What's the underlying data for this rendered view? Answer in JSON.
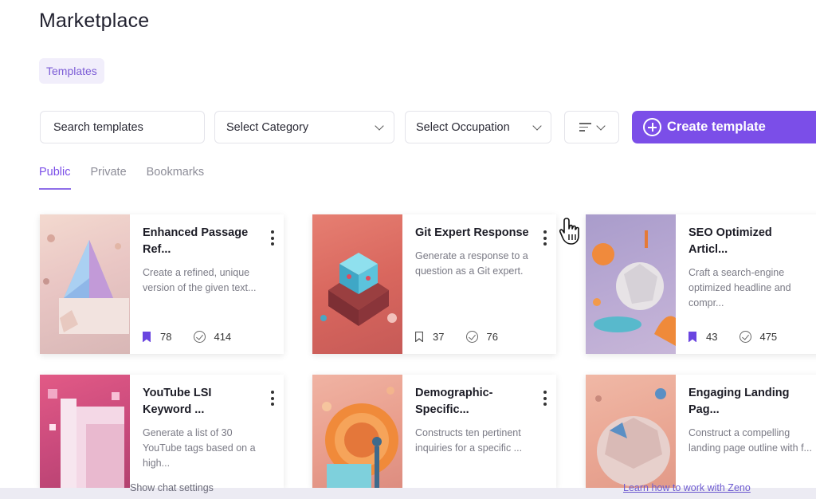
{
  "header": {
    "title": "Marketplace"
  },
  "chip": {
    "label": "Templates"
  },
  "toolbar": {
    "search_placeholder": "Search templates",
    "category_label": "Select Category",
    "occupation_label": "Select Occupation",
    "sort_icon": "sort-icon",
    "create_label": "Create template"
  },
  "tabs": [
    {
      "label": "Public",
      "active": true
    },
    {
      "label": "Private",
      "active": false
    },
    {
      "label": "Bookmarks",
      "active": false
    }
  ],
  "cards": [
    {
      "title": "Enhanced Passage Ref...",
      "description": "Create a refined, unique version of the given text...",
      "bookmarks": "78",
      "uses": "414",
      "bookmarked": true
    },
    {
      "title": "Git Expert Response",
      "description": "Generate a response to a question as a Git expert.",
      "bookmarks": "37",
      "uses": "76",
      "bookmarked": false
    },
    {
      "title": "SEO Optimized Articl...",
      "description": "Craft a search-engine optimized headline and compr...",
      "bookmarks": "43",
      "uses": "475",
      "bookmarked": true
    },
    {
      "title": "YouTube LSI Keyword ...",
      "description": "Generate a list of 30 YouTube tags based on a high...",
      "bookmarks": "",
      "uses": "",
      "bookmarked": false
    },
    {
      "title": "Demographic-Specific...",
      "description": "Constructs ten pertinent inquiries for a specific ...",
      "bookmarks": "",
      "uses": "",
      "bookmarked": false
    },
    {
      "title": "Engaging Landing Pag...",
      "description": "Construct a compelling landing page outline with f...",
      "bookmarks": "",
      "uses": "",
      "bookmarked": false
    }
  ],
  "footer": {
    "left_text": "Show chat settings",
    "right_text": "Learn how to work with Zeno"
  },
  "colors": {
    "accent": "#7b4ee8",
    "chip_bg": "#f1eefb"
  }
}
